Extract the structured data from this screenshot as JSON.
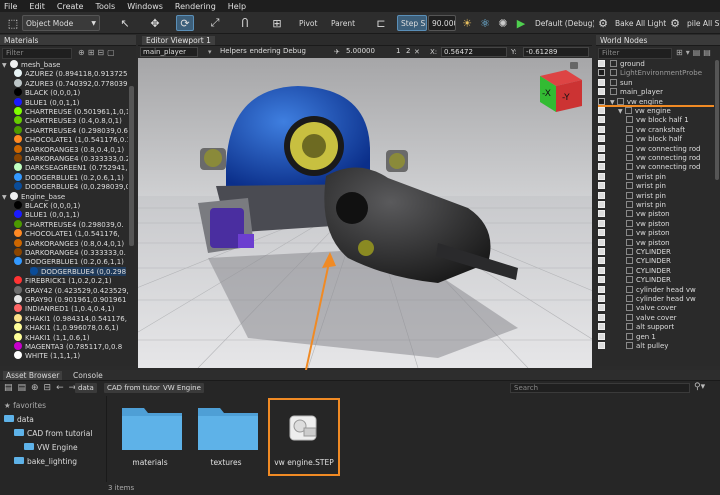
{
  "menu": [
    "File",
    "Edit",
    "Create",
    "Tools",
    "Windows",
    "Rendering",
    "Help"
  ],
  "toolbar": {
    "mode": "Object Mode",
    "pivot": "Pivot",
    "parent": "Parent",
    "step_size_label": "Step Size",
    "step_size_value": "90.000",
    "config": "Default (Debug)",
    "bake": "Bake All Lighting",
    "compile": "pile All Sh"
  },
  "materials": {
    "title": "Materials",
    "filter_placeholder": "Filter",
    "groups": [
      {
        "name": "mesh_base",
        "items": [
          {
            "label": "AZURE2 (0.894118,0.913725,0.",
            "color": "#e8f4f6"
          },
          {
            "label": "AZURE3 (0.740392,0.778039,0.",
            "color": "#bdc6c8"
          },
          {
            "label": "BLACK (0,0,0,1)",
            "color": "#000000"
          },
          {
            "label": "BLUE1 (0,0,1,1)",
            "color": "#1a1aff"
          },
          {
            "label": "CHARTREUSE (0.501961,1,0,1)",
            "color": "#80ff00"
          },
          {
            "label": "CHARTREUSE3 (0.4,0.8,0,1)",
            "color": "#66cc00"
          },
          {
            "label": "CHARTREUSE4 (0.298039,0.6,0",
            "color": "#4c9900"
          },
          {
            "label": "CHOCOLATE1 (1,0.541176,0.14",
            "color": "#ff8a24"
          },
          {
            "label": "DARKORANGE3 (0.8,0.4,0,1)",
            "color": "#cc6600"
          },
          {
            "label": "DARKORANGE4 (0.333333,0.2",
            "color": "#8b4500"
          },
          {
            "label": "DARKSEAGREEN1 (0.752941,1,",
            "color": "#c0ffc1"
          },
          {
            "label": "DODGERBLUE1 (0.2,0.6,1,1)",
            "color": "#3399ff"
          },
          {
            "label": "DODGERBLUE4 (0,0.298039,0.6",
            "color": "#0a4c99"
          }
        ]
      },
      {
        "name": "Engine_base",
        "items": [
          {
            "label": "BLACK (0,0,0,1)",
            "color": "#000000"
          },
          {
            "label": "BLUE1 (0,0,1,1)",
            "color": "#1a1aff"
          },
          {
            "label": "CHARTREUSE4 (0.298039,0.",
            "color": "#4c9900"
          },
          {
            "label": "CHOCOLATE1 (1,0.541176,",
            "color": "#ff8a24"
          },
          {
            "label": "DARKORANGE3 (0.8,0.4,0,1)",
            "color": "#cc6600"
          },
          {
            "label": "DARKORANGE4 (0.333333,0.",
            "color": "#8b4500"
          },
          {
            "label": "DODGERBLUE1 (0.2,0.6,1,1)",
            "color": "#3399ff"
          },
          {
            "label": "DODGERBLUE4 (0,0.298",
            "color": "#0a4c99"
          },
          {
            "label": "FIREBRICK1 (1,0.2,0.2,1)",
            "color": "#ff3333"
          },
          {
            "label": "GRAY42 (0.423529,0.423529,",
            "color": "#6c6c6c"
          },
          {
            "label": "GRAY90 (0.901961,0.901961",
            "color": "#e6e6e6"
          },
          {
            "label": "INDIANRED1 (1,0.4,0.4,1)",
            "color": "#ff6666"
          },
          {
            "label": "KHAKI1 (0.984314,0.541176,",
            "color": "#fbe28a"
          },
          {
            "label": "KHAKI1 (1,0.996078,0.6,1)",
            "color": "#fffe99"
          },
          {
            "label": "KHAKI1 (1,1,0.6,1)",
            "color": "#ffff99"
          },
          {
            "label": "MAGENTA3 (0.785117,0,0.8",
            "color": "#c800cc"
          },
          {
            "label": "WHITE (1,1,1,1)",
            "color": "#ffffff"
          }
        ]
      }
    ]
  },
  "viewport": {
    "tab": "Editor Viewport 1",
    "camera": "main_player",
    "helpers": "Helpers",
    "rendering_debug": "Rendering Debug",
    "speed": "5.00000",
    "cam_1": "1",
    "cam_2": "2",
    "coord_x_label": "X:",
    "coord_x": "0.56472",
    "coord_y_label": "Y:",
    "coord_y": "-0.61289",
    "gizmo_x": "-X",
    "gizmo_y": "-Y"
  },
  "world_nodes": {
    "title": "World Nodes",
    "filter_placeholder": "Filter",
    "items": [
      {
        "label": "ground",
        "depth": 0,
        "check": "on"
      },
      {
        "label": "LightEnvironmentProbe",
        "depth": 0,
        "check": "off",
        "dim": true
      },
      {
        "label": "sun",
        "depth": 0,
        "check": "on"
      },
      {
        "label": "main_player",
        "depth": 0,
        "check": "on"
      },
      {
        "label": "vw engine",
        "depth": 0,
        "check": "off",
        "selected": true
      },
      {
        "label": "vw engine",
        "depth": 1,
        "check": "on"
      },
      {
        "label": "vw block half 1",
        "depth": 2,
        "check": "on"
      },
      {
        "label": "vw crankshaft",
        "depth": 2,
        "check": "on"
      },
      {
        "label": "vw block half",
        "depth": 2,
        "check": "on"
      },
      {
        "label": "vw connecting rod",
        "depth": 2,
        "check": "on"
      },
      {
        "label": "vw connecting rod",
        "depth": 2,
        "check": "on"
      },
      {
        "label": "vw connecting rod",
        "depth": 2,
        "check": "on"
      },
      {
        "label": "wrist pin",
        "depth": 2,
        "check": "on"
      },
      {
        "label": "wrist pin",
        "depth": 2,
        "check": "on"
      },
      {
        "label": "wrist pin",
        "depth": 2,
        "check": "on"
      },
      {
        "label": "wrist pin",
        "depth": 2,
        "check": "on"
      },
      {
        "label": "vw piston",
        "depth": 2,
        "check": "on"
      },
      {
        "label": "vw piston",
        "depth": 2,
        "check": "on"
      },
      {
        "label": "vw piston",
        "depth": 2,
        "check": "on"
      },
      {
        "label": "vw piston",
        "depth": 2,
        "check": "on"
      },
      {
        "label": "CYLINDER",
        "depth": 2,
        "check": "on"
      },
      {
        "label": "CYLINDER",
        "depth": 2,
        "check": "on"
      },
      {
        "label": "CYLINDER",
        "depth": 2,
        "check": "on"
      },
      {
        "label": "CYLINDER",
        "depth": 2,
        "check": "on"
      },
      {
        "label": "cylinder head vw",
        "depth": 2,
        "check": "on"
      },
      {
        "label": "cylinder head vw",
        "depth": 2,
        "check": "on"
      },
      {
        "label": "valve cover",
        "depth": 2,
        "check": "on"
      },
      {
        "label": "valve cover",
        "depth": 2,
        "check": "on"
      },
      {
        "label": "alt support",
        "depth": 2,
        "check": "on"
      },
      {
        "label": "gen 1",
        "depth": 2,
        "check": "on"
      },
      {
        "label": "alt pulley",
        "depth": 2,
        "check": "on"
      }
    ]
  },
  "asset_browser": {
    "tabs": [
      "Asset Browser",
      "Console"
    ],
    "breadcrumbs": [
      "data",
      "CAD from tutorial",
      "VW Engine"
    ],
    "search_placeholder": "Search",
    "tree": [
      {
        "label": "favorites",
        "depth": 0
      },
      {
        "label": "data",
        "depth": 0
      },
      {
        "label": "CAD from tutorial",
        "depth": 1
      },
      {
        "label": "VW Engine",
        "depth": 2
      },
      {
        "label": "bake_lighting",
        "depth": 1
      }
    ],
    "files": [
      {
        "label": "materials",
        "kind": "folder"
      },
      {
        "label": "textures",
        "kind": "folder"
      },
      {
        "label": "vw engine.STEP",
        "kind": "file",
        "highlighted": true
      }
    ],
    "status": "3 items"
  },
  "colors": {
    "accent": "#5a8fb8",
    "highlight": "#f08a24",
    "folder": "#5eb2e8"
  }
}
